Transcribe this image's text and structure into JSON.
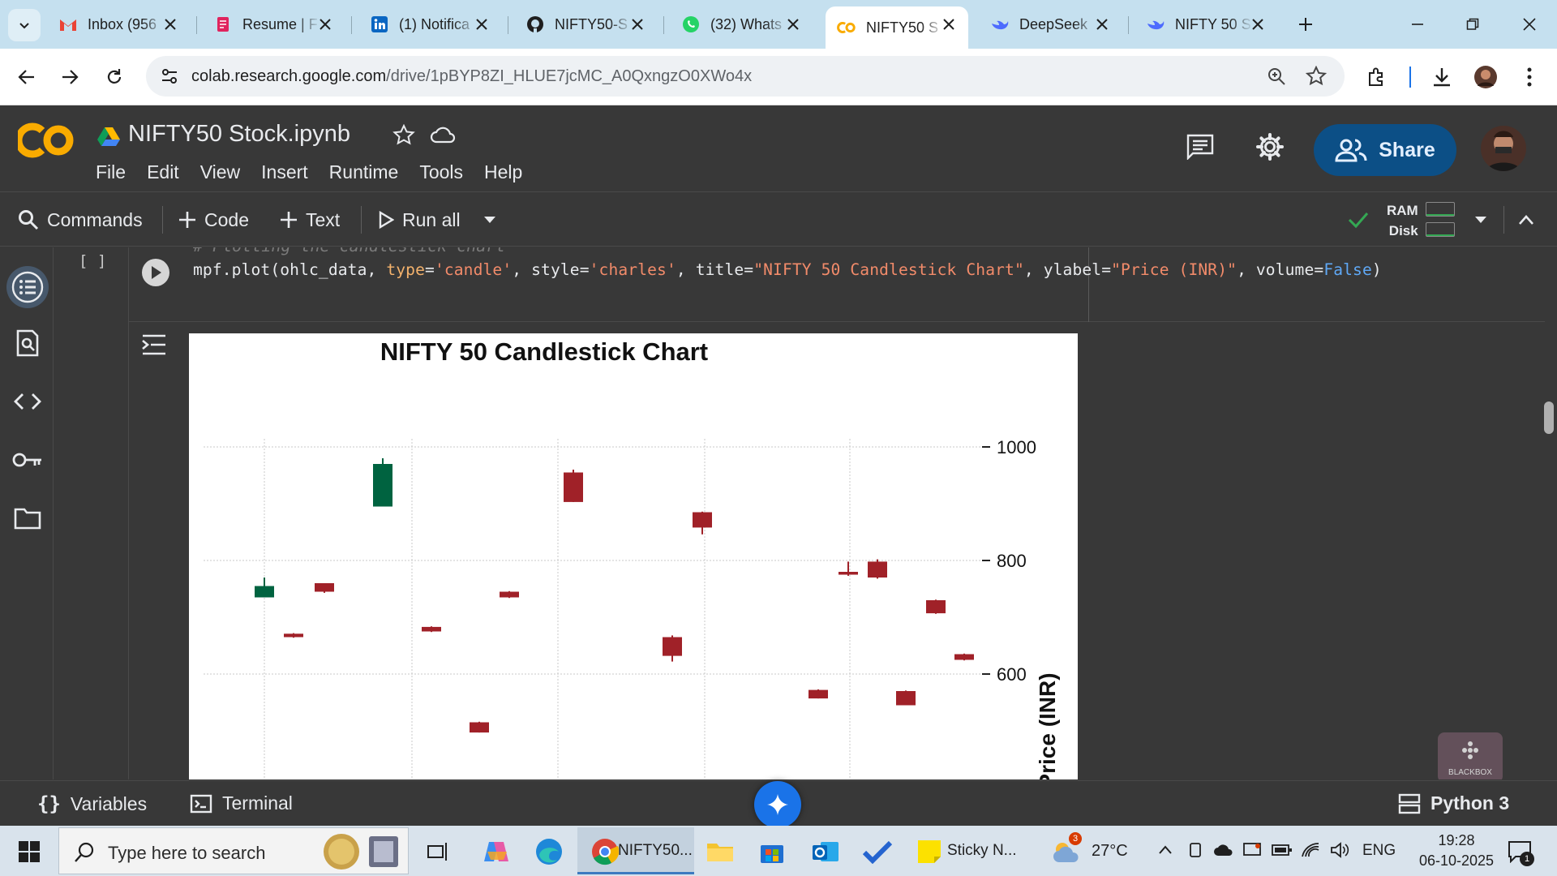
{
  "browser": {
    "tabs": [
      {
        "title": "Inbox (956",
        "icon": "gmail-icon",
        "active": false
      },
      {
        "title": "Resume | F",
        "icon": "resume-icon",
        "active": false
      },
      {
        "title": "(1) Notifica",
        "icon": "linkedin-icon",
        "active": false
      },
      {
        "title": "NIFTY50-S",
        "icon": "github-icon",
        "active": false
      },
      {
        "title": "(32) Whats",
        "icon": "whatsapp-icon",
        "active": false
      },
      {
        "title": "NIFTY50 S",
        "icon": "colab-icon",
        "active": true
      },
      {
        "title": "DeepSeek",
        "icon": "deepseek-icon",
        "active": false
      },
      {
        "title": "NIFTY 50 S",
        "icon": "deepseek-icon",
        "active": false
      }
    ],
    "url_domain": "colab.research.google.com",
    "url_path": "/drive/1pBYP8ZI_HLUE7jcMC_A0QxngzO0XWo4x"
  },
  "colab": {
    "notebook_title": "NIFTY50 Stock.ipynb",
    "menu": [
      "File",
      "Edit",
      "View",
      "Insert",
      "Runtime",
      "Tools",
      "Help"
    ],
    "share_label": "Share",
    "toolbar": {
      "commands": "Commands",
      "code": "Code",
      "text": "Text",
      "run_all": "Run all",
      "ram": "RAM",
      "disk": "Disk"
    },
    "cell": {
      "exec_count": "[ ]",
      "comment": "# Plotting the candlestick chart",
      "code_parts": [
        {
          "t": "mpf.plot(ohlc_data, ",
          "c": "plain"
        },
        {
          "t": "type",
          "c": "kw"
        },
        {
          "t": "=",
          "c": "plain"
        },
        {
          "t": "'candle'",
          "c": "str"
        },
        {
          "t": ", style=",
          "c": "plain"
        },
        {
          "t": "'charles'",
          "c": "str"
        },
        {
          "t": ", title=",
          "c": "plain"
        },
        {
          "t": "\"NIFTY 50 Candlestick Chart\"",
          "c": "str"
        },
        {
          "t": ", ylabel=",
          "c": "plain"
        },
        {
          "t": "\"Price (INR)\"",
          "c": "str"
        },
        {
          "t": ", volume=",
          "c": "plain"
        },
        {
          "t": "False",
          "c": "bool"
        },
        {
          "t": ")",
          "c": "plain"
        }
      ]
    },
    "statusbar": {
      "variables": "Variables",
      "terminal": "Terminal",
      "kernel": "Python 3"
    }
  },
  "chart_data": {
    "type": "candlestick",
    "title": "NIFTY 50 Candlestick Chart",
    "ylabel": "Price (INR)",
    "yticks": [
      600,
      800,
      1000
    ],
    "ylim": [
      440,
      1090
    ],
    "grid": true,
    "candles": [
      {
        "open": 735,
        "close": 755,
        "high": 770,
        "low": 737
      },
      {
        "open": 671,
        "close": 665,
        "high": 672,
        "low": 664
      },
      {
        "open": 760,
        "close": 745,
        "high": 760,
        "low": 743
      },
      {
        "open": 895,
        "close": 970,
        "high": 980,
        "low": 895
      },
      {
        "open": 683,
        "close": 675,
        "high": 684,
        "low": 674
      },
      {
        "open": 515,
        "close": 497,
        "high": 516,
        "low": 497
      },
      {
        "open": 745,
        "close": 735,
        "high": 746,
        "low": 734
      },
      {
        "open": 955,
        "close": 903,
        "high": 960,
        "low": 903
      },
      {
        "open": 665,
        "close": 632,
        "high": 668,
        "low": 622
      },
      {
        "open": 885,
        "close": 858,
        "high": 886,
        "low": 846
      },
      {
        "open": 572,
        "close": 557,
        "high": 573,
        "low": 557
      },
      {
        "open": 780,
        "close": 775,
        "high": 798,
        "low": 773
      },
      {
        "open": 570,
        "close": 545,
        "high": 571,
        "low": 545
      },
      {
        "open": 798,
        "close": 770,
        "high": 802,
        "low": 768
      },
      {
        "open": 730,
        "close": 707,
        "high": 731,
        "low": 706
      },
      {
        "open": 635,
        "close": 625,
        "high": 636,
        "low": 624
      }
    ],
    "colors": {
      "up": "#006340",
      "down": "#a02128",
      "grid": "#c8c8c8"
    }
  },
  "taskbar": {
    "search_placeholder": "Type here to search",
    "chrome_label": "NIFTY50...",
    "sticky_label": "Sticky N...",
    "weather": "27°C",
    "weather_badge": "3",
    "lang": "ENG",
    "time": "19:28",
    "date": "06-10-2025",
    "notif_count": "1",
    "blackbox_label": "BLACKBOX"
  }
}
